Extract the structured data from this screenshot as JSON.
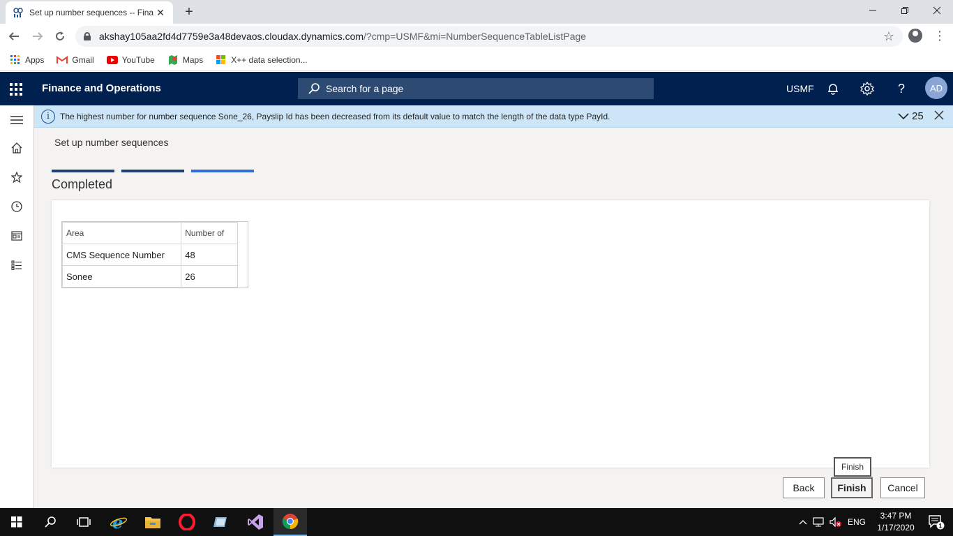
{
  "browser": {
    "tab_title": "Set up number sequences -- Fina",
    "new_tab": "+",
    "url_host": "akshay105aa2fd4d7759e3a48devaos.cloudax.dynamics.com",
    "url_path": "/?cmp=USMF&mi=NumberSequenceTableListPage",
    "bookmarks": [
      {
        "label": "Apps",
        "icon": "apps-grid-icon"
      },
      {
        "label": "Gmail",
        "icon": "gmail-icon"
      },
      {
        "label": "YouTube",
        "icon": "youtube-icon"
      },
      {
        "label": "Maps",
        "icon": "maps-icon"
      },
      {
        "label": "X++ data selection...",
        "icon": "windows-logo-icon"
      }
    ]
  },
  "app": {
    "name": "Finance and Operations",
    "search_placeholder": "Search for a page",
    "company": "USMF",
    "help": "?",
    "avatar_initials": "AD"
  },
  "message_bar": {
    "text": "The highest number for number sequence Sone_26, Payslip Id has been decreased from its default value to match the length of the data type PayId.",
    "count": "25",
    "info": "i"
  },
  "page": {
    "title": "Set up number sequences",
    "step_heading": "Completed",
    "step_colors": [
      "#1e3f78",
      "#1e3f78",
      "#2f6ed9"
    ]
  },
  "grid": {
    "columns": [
      "Area",
      "Number of"
    ],
    "rows": [
      {
        "area": "CMS Sequence Number",
        "number": "48"
      },
      {
        "area": "Sonee",
        "number": "26"
      }
    ]
  },
  "footer": {
    "tooltip": "Finish",
    "back": "Back",
    "finish": "Finish",
    "cancel": "Cancel"
  },
  "taskbar": {
    "language": "ENG",
    "time": "3:47 PM",
    "date": "1/17/2020",
    "notification_count": "1"
  }
}
